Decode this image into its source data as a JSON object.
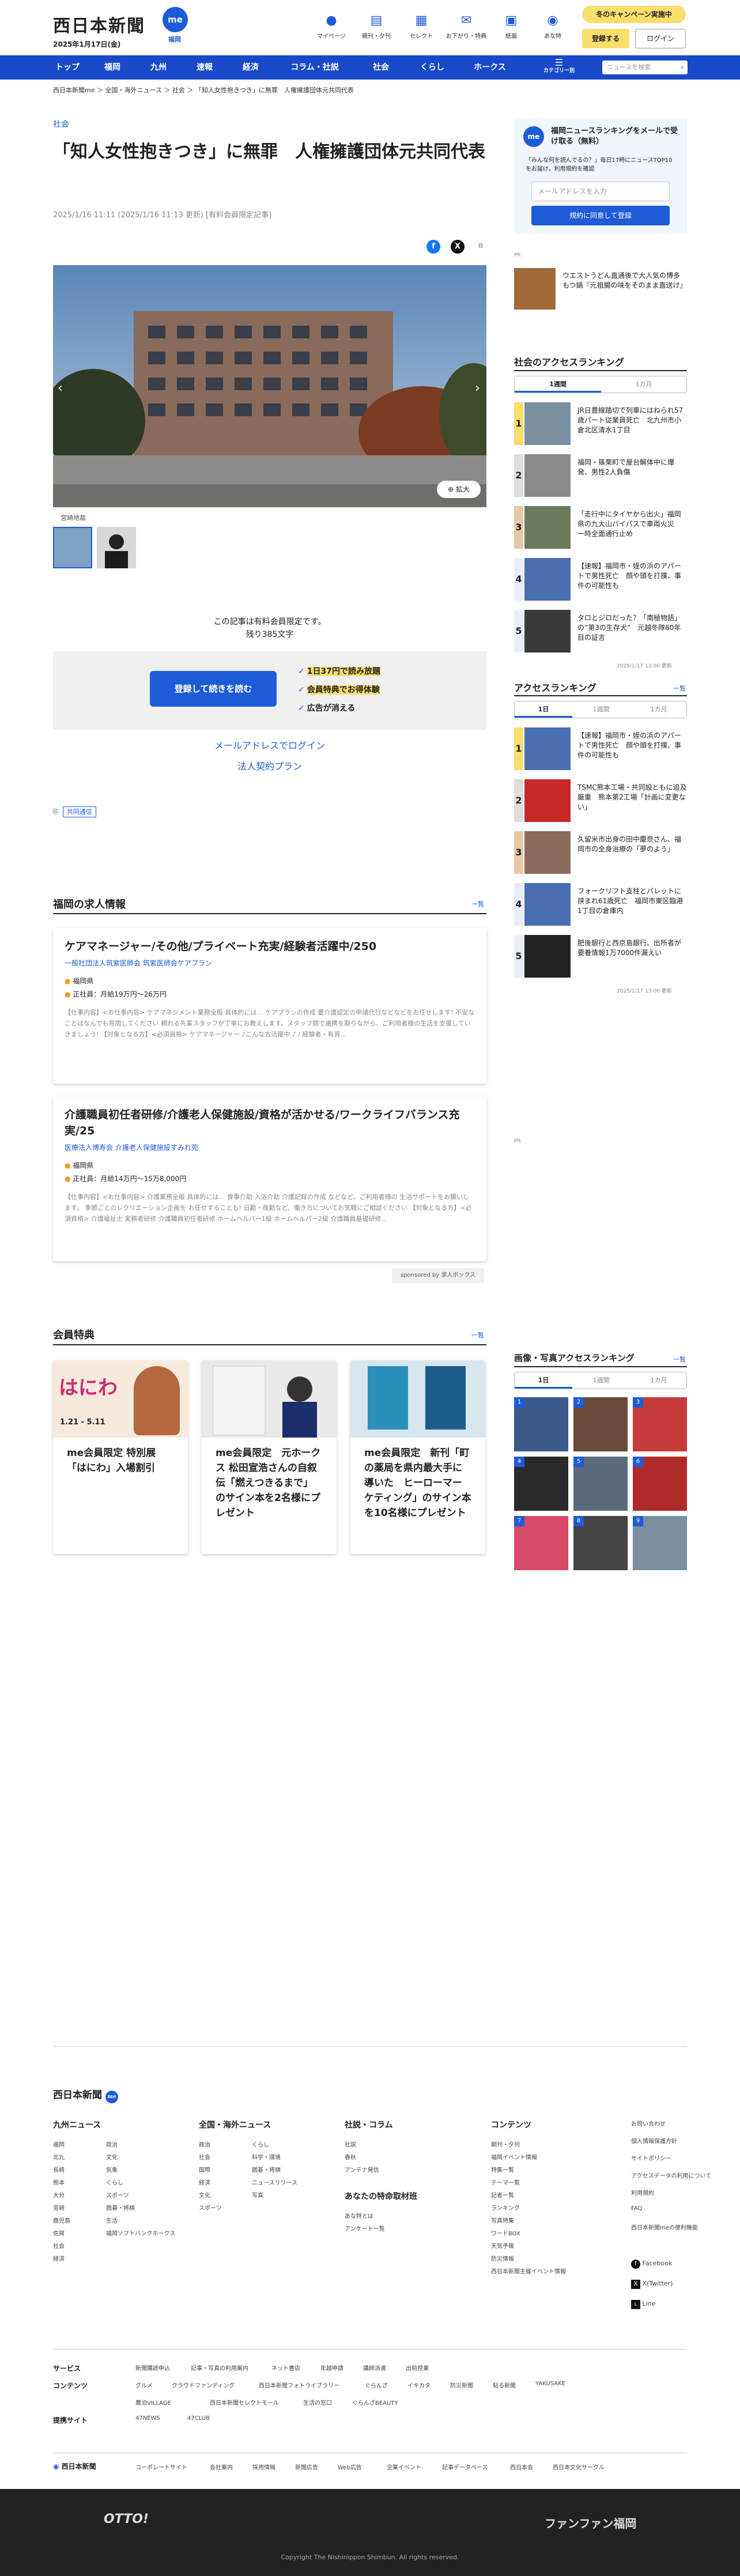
{
  "header": {
    "logo": "西日本新聞",
    "date": "2025年1月17日(金)",
    "me_badge": "me",
    "me_sub": "福岡",
    "icons": [
      {
        "label": "マイページ",
        "icon": "person-icon"
      },
      {
        "label": "親刊・夕刊",
        "icon": "newspaper-icon"
      },
      {
        "label": "セレクト",
        "icon": "select-icon"
      },
      {
        "label": "お下がり・特典",
        "icon": "gift-icon"
      },
      {
        "label": "紙面",
        "icon": "paper-icon"
      },
      {
        "label": "あな特",
        "icon": "owl-icon"
      }
    ],
    "campaign": "冬のキャンペーン実施中",
    "register": "登録する",
    "login": "ログイン"
  },
  "nav": {
    "items": [
      "トップ",
      "福岡",
      "九州",
      "速報",
      "経済",
      "コラム・社説",
      "社会",
      "くらし",
      "ホークス"
    ],
    "menu": "カテゴリー別",
    "search_placeholder": "ニュースを検索"
  },
  "breadcrumb": "西日本新聞me ＞ 全国・海外ニュース ＞ 社会 ＞ 「知人女性抱きつき」に無罪　人権擁護団体元共同代表",
  "article": {
    "category": "社会",
    "title": "「知人女性抱きつき」に無罪　人権擁護団体元共同代表",
    "date": "2025/1/16 11:11 (2025/1/16 11:13 更新) [有料会員限定記事]",
    "zoom": "拡大",
    "caption": "宮崎地裁",
    "locked_1": "この記事は有料会員限定です。",
    "locked_2": "残り385文字",
    "pay_button": "登録して続きを読む",
    "features": [
      "1日37円で読み放題",
      "会員特典でお得体験",
      "広告が消える"
    ],
    "email_login": "メールアドレスでログイン",
    "corp_plan": "法人契約プラン",
    "kyodo": "共同通信"
  },
  "jobs": {
    "heading": "福岡の求人情報",
    "more": "一覧",
    "items": [
      {
        "title": "ケアマネージャー/その他/プライベート充実/経験者活躍中/250",
        "company": "一般社団法人筑紫医師会 筑紫医師会ケアプラン",
        "location": "福岡県",
        "pay": "正社員：月給19万円〜26万円",
        "desc": "【仕事内容】<お仕事内容> ケアマネジメント業務全般 具体的には… ケアプランの作成 要介護認定の申請代行などなどをお任せします! 不安なことはなんでも質問してください 頼れる先輩スタッフが丁寧にお教えします。スタッフ間で連携を取りながら、ご利用者様の生活を支援していきましょう! 【対象となる方】<必須資格> ケアマネージャー ♪こんな方活躍中 ♪ / 経験者・有資..."
      },
      {
        "title": "介護職員初任者研修/介護老人保健施設/資格が活かせる/ワークライフバランス充実/25",
        "company": "医療法人博寿会 介護老人保健施設すみれ苑",
        "location": "福岡県",
        "pay": "正社員：月給14万円〜15万8,000円",
        "desc": "【仕事内容】<お仕事内容> 介護業務全般 具体的には… 食事介助 入浴介助 介護記録の作成 などなど、ご利用者様の 生活サポートをお願いします。 季節ごとのレクリエーション企画を お任せすることも! 日勤・夜勤など、働き方についてお気軽にご相談ください 【対象となる方】<必須資格> 介護福祉士 実務者研修 介護職員初任者研修 ホームヘルパー1級 ホームヘルパー2級 介護職員基礎研修..."
      }
    ],
    "sponsor": "sponsored by 求人ボックス"
  },
  "perks": {
    "heading": "会員特典",
    "more": "一覧",
    "items": [
      {
        "title": "me会員限定 特別展「はにわ」入場割引",
        "img_text": "はにわ",
        "img_date": "1.21 - 5.11"
      },
      {
        "title": "me会員限定　元ホークス 松田宣浩さんの自叙伝「燃えつきるまで」のサイン本を2名様にプレゼント"
      },
      {
        "title": "me会員限定　新刊「町の薬局を県内最大手に導いた　ヒーローマーケティング」のサイン本を10名様にプレゼント"
      }
    ]
  },
  "sidebar": {
    "mail_title": "福岡ニュースランキングをメールで受け取る（無料）",
    "mail_desc": "「みんな何を読んでるの？」毎日17時にニュースTOP10をお届け。利用規約を確認",
    "mail_placeholder": "メールアドレスを入力",
    "mail_button": "規約に同意して登録",
    "ad": "PR",
    "ad_text": "ウエストうどん直通後で大人気の博多もつ鍋『元祖腸の味をそのまま直送け』",
    "social": {
      "heading": "社会のアクセスランキング",
      "tabs": [
        "1週間",
        "1カ月"
      ],
      "items": [
        "JR日豊線踏切で列車にはねられ57歳パート従業員死亡　北九州市小倉北区清水1丁目",
        "福岡・篠栗町で屋台解体中に爆発、男性2人負傷",
        "「走行中にタイヤから出火」福岡県の九大山バイパスで車両火災　一時全面通行止め",
        "【速報】福岡市・姪の浜のアパートで男性死亡　顔や頭を打撲、事件の可能性も",
        "タロとジロだった？「南極物語」の“第3の生存犬”　元越冬隊60年目の証言"
      ],
      "updated": "2025/1/17 13:00 更新"
    },
    "access": {
      "heading": "アクセスランキング",
      "more": "一覧",
      "tabs": [
        "1日",
        "1週間",
        "1カ月"
      ],
      "items": [
        "【速報】福岡市・姪の浜のアパートで男性死亡　顔や頭を打撲、事件の可能性も",
        "TSMC熊本工場・共同設ともに追及厳重　熊本第2工場「計画に変更ない」",
        "久留米市出身の田中慶奈さん、福岡市の全身治療の「夢のよう」",
        "フォークリフト支柱とパレットに挟まれ61歳死亡　福岡市東区臨港1丁目の倉庫内",
        "肥後銀行と西京島銀行、出所者が要養情報1万7000件漏えい"
      ],
      "updated": "2025/1/17 13:00 更新"
    },
    "photo_rank": {
      "heading": "画像・写真アクセスランキング",
      "more": "一覧",
      "tabs": [
        "1日",
        "1週間",
        "1カ月"
      ]
    }
  },
  "footer": {
    "logo": "西日本新聞",
    "cols": [
      {
        "h": "九州ニュース",
        "links": [
          "福岡",
          "北九",
          "長崎",
          "熊本",
          "大分",
          "宮崎",
          "鹿児島",
          "佐賀",
          "社会",
          "経済",
          "政治",
          "文化",
          "気象",
          "くらし",
          "スポーツ",
          "囲碁・将棋",
          "生活",
          "福岡ソフトバンクホークス"
        ]
      },
      {
        "h": "全国・海外ニュース",
        "links": [
          "政治",
          "社会",
          "国際",
          "経済",
          "文化",
          "スポーツ",
          "くらし",
          "科学・環境",
          "囲碁・将棋",
          "ニュースリリース",
          "写真"
        ]
      },
      {
        "h": "社説・コラム",
        "links": [
          "社説",
          "春秋",
          "アンテナ発信"
        ]
      },
      {
        "h": "あなたの特命取材班",
        "links": [
          "あな特とは",
          "アンケート一覧"
        ]
      },
      {
        "h": "コンテンツ",
        "links": [
          "朝刊・夕刊",
          "福岡イベント情報",
          "特集一覧",
          "テーマ一覧",
          "記者一覧",
          "ランキング",
          "写真特集",
          "ワードBOX",
          "天気予報",
          "防災情報",
          "西日本新聞主催イベント情報"
        ]
      }
    ],
    "side_links": [
      "お問い合わせ",
      "個人情報保護方針",
      "サイトポリシー",
      "アクセスデータの利用について",
      "利用規約",
      "FAQ",
      "西日本新聞meの便利機能"
    ],
    "sns": [
      "Facebook",
      "X(Twitter)",
      "Line"
    ],
    "services_h": "サービス",
    "services": [
      "新聞購読申込",
      "記事・写真の利用案内",
      "ネット書店",
      "年越申請",
      "講師派遣",
      "出前授業"
    ],
    "contents_h": "コンテンツ",
    "contents": [
      "グルメ",
      "クラウドファンディング",
      "西日本新聞フォトライブラリー",
      "ぐらんざ",
      "イキカタ",
      "防災新聞",
      "貼る新聞",
      "YAKUSAKE",
      "農泊VILLAGE",
      "西日本新聞セレクトモール",
      "生活の窓口",
      "ぐらんざBEAUTY"
    ],
    "partner_h": "提携サイト",
    "partners": [
      "47NEWS",
      "47CLUB"
    ],
    "corp": [
      "コーポレートサイト",
      "会社案内",
      "採用情報",
      "新聞広告",
      "Web広告",
      "企業イベント",
      "記事データベース",
      "西日本会",
      "西日本文化サークル"
    ],
    "otto": "OTTO!",
    "fanfan": "ファンファン福岡",
    "copyright": "Copyright The Nishinippon Shimbun. All rights reserved."
  }
}
